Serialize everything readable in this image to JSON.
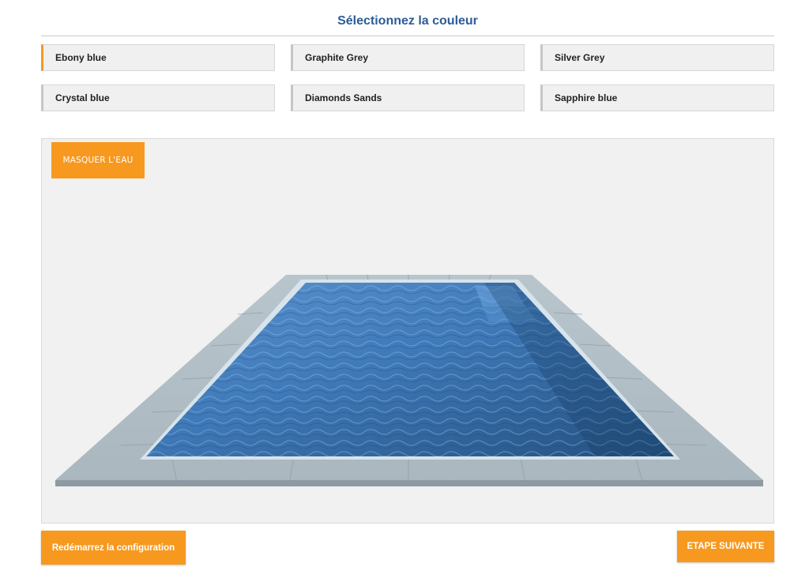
{
  "header": {
    "title": "Sélectionnez la couleur"
  },
  "colors": {
    "selected": "Ebony blue",
    "items": [
      {
        "label": "Ebony blue"
      },
      {
        "label": "Graphite Grey"
      },
      {
        "label": "Silver Grey"
      },
      {
        "label": "Crystal blue"
      },
      {
        "label": "Diamonds Sands"
      },
      {
        "label": "Sapphire blue"
      }
    ]
  },
  "viewer": {
    "hide_water_label": "MASQUER L'EAU"
  },
  "footer": {
    "restart_label": "Redémarrez la configuration",
    "next_label": "ETAPE SUIVANTE"
  },
  "theme": {
    "accent": "#f7991e",
    "title_color": "#2c5c96",
    "water": "#3f79b8"
  }
}
